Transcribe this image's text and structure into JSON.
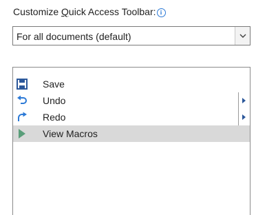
{
  "toolbar_setting": {
    "heading_prefix": "Customize ",
    "heading_accel": "Q",
    "heading_suffix": "uick Access Toolbar:",
    "info_icon": "info-icon",
    "scope_value": "For all documents (default)",
    "dropdown_icon": "chevron-down-icon"
  },
  "commands": [
    {
      "label": "Save",
      "icon": "save-icon",
      "has_submenu": false,
      "selected": false
    },
    {
      "label": "Undo",
      "icon": "undo-icon",
      "has_submenu": true,
      "selected": false
    },
    {
      "label": "Redo",
      "icon": "redo-icon",
      "has_submenu": true,
      "selected": false
    },
    {
      "label": "View Macros",
      "icon": "play-macro-icon",
      "has_submenu": false,
      "selected": true
    }
  ],
  "colors": {
    "save": "#2b579a",
    "undo": "#2b79d6",
    "redo": "#2b79d6",
    "macro": "#5a9e7a",
    "selected_row": "#d9d9d9"
  }
}
